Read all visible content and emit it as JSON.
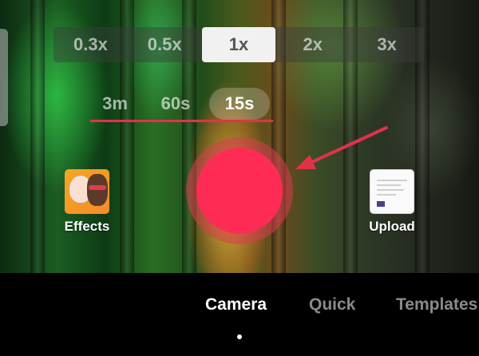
{
  "zoom": {
    "options": [
      "0.3x",
      "0.5x",
      "1x",
      "2x",
      "3x"
    ],
    "selected": "1x"
  },
  "duration": {
    "options": [
      "3m",
      "60s",
      "15s"
    ],
    "selected": "15s"
  },
  "effects": {
    "label": "Effects",
    "icon": "effects-thumbnail"
  },
  "upload": {
    "label": "Upload",
    "icon": "gallery-thumbnail"
  },
  "record": {
    "color": "#fe2c55",
    "ring_color": "#d73c50"
  },
  "annotation": {
    "color": "#e0324b",
    "icon": "red-arrow"
  },
  "modes": {
    "tabs": [
      "Camera",
      "Quick",
      "Templates"
    ],
    "selected": "Camera"
  }
}
